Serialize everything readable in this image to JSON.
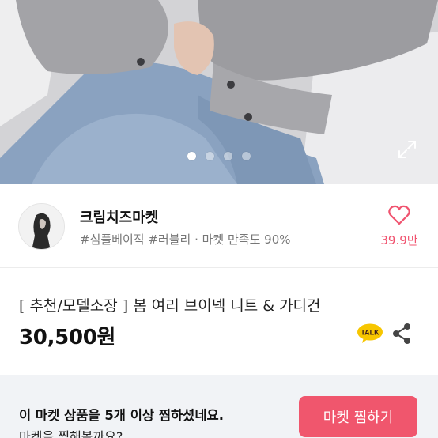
{
  "hero": {
    "image_alt": "",
    "slide_count": 4,
    "active_slide": 0
  },
  "shop": {
    "name": "크림치즈마켓",
    "meta": "#심플베이직 #러블리 · 마켓 만족도 90%",
    "like_count": "39.9만"
  },
  "product": {
    "title": "[ 추천/모델소장 ] 봄 여리 브이넥 니트 & 가디건",
    "price": "30,500원"
  },
  "banner": {
    "line1": "이 마켓 상품을 5개 이상 찜하셨네요.",
    "line2": "마켓을 찜해볼까요?",
    "button_label": "마켓 찜하기"
  },
  "colors": {
    "accent": "#f0566d",
    "banner_bg": "#f1f3f6",
    "talk_badge": "#f7c600"
  },
  "icons": {
    "like": "heart-outline-icon",
    "share": "share-icon",
    "talk": "talk-icon",
    "expand": "expand-icon"
  }
}
